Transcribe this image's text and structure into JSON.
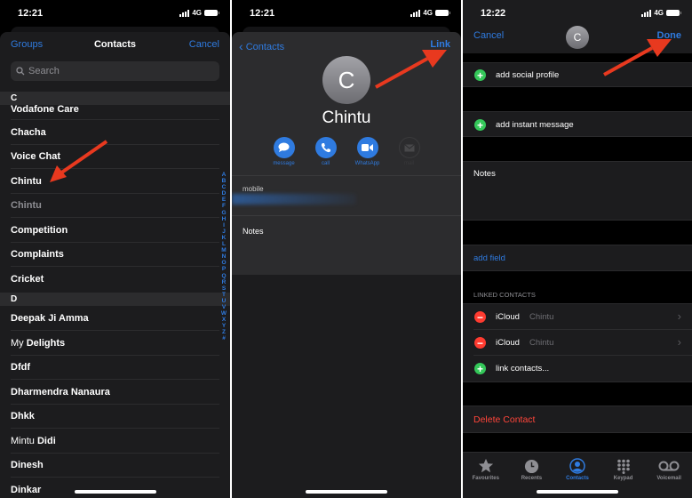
{
  "screen1": {
    "status": {
      "time": "12:21",
      "network": "4G"
    },
    "nav": {
      "left": "Groups",
      "title": "Contacts",
      "right": "Cancel"
    },
    "search": {
      "placeholder": "Search"
    },
    "sections": [
      {
        "letter": "C",
        "rows": [
          {
            "name": "Vodafone Care",
            "style": "bold"
          },
          {
            "name": "Chacha",
            "style": "bold"
          },
          {
            "name": "Voice Chat",
            "style": "bold"
          },
          {
            "name": "Chintu",
            "style": "bold"
          },
          {
            "name": "Chintu",
            "style": "dim"
          },
          {
            "name": "Competition",
            "style": "bold"
          },
          {
            "name": "Complaints",
            "style": "bold"
          },
          {
            "name": "Cricket",
            "style": "bold"
          }
        ]
      },
      {
        "letter": "D",
        "rows": [
          {
            "name": "Deepak Ji Amma",
            "style": "bold"
          },
          {
            "first": "My",
            "last": "Delights",
            "style": "mixed"
          },
          {
            "name": "Dfdf",
            "style": "bold"
          },
          {
            "name": "Dharmendra Nanaura",
            "style": "bold"
          },
          {
            "name": "Dhkk",
            "style": "bold"
          },
          {
            "first": "Mintu",
            "last": "Didi",
            "style": "mixed"
          },
          {
            "name": "Dinesh",
            "style": "bold"
          },
          {
            "name": "Dinkar",
            "style": "bold"
          }
        ]
      }
    ],
    "index": [
      "A",
      "B",
      "C",
      "D",
      "E",
      "F",
      "G",
      "H",
      "I",
      "J",
      "K",
      "L",
      "M",
      "N",
      "O",
      "P",
      "Q",
      "R",
      "S",
      "T",
      "U",
      "V",
      "W",
      "X",
      "Y",
      "Z",
      "#"
    ]
  },
  "screen2": {
    "status": {
      "time": "12:21",
      "network": "4G"
    },
    "nav": {
      "back": "Contacts",
      "right": "Link"
    },
    "avatar_initial": "C",
    "contact_name": "Chintu",
    "actions": [
      {
        "label": "message",
        "icon": "message-icon",
        "enabled": true
      },
      {
        "label": "call",
        "icon": "phone-icon",
        "enabled": true
      },
      {
        "label": "WhatsApp",
        "icon": "video-icon",
        "enabled": true
      },
      {
        "label": "mail",
        "icon": "mail-icon",
        "enabled": false
      }
    ],
    "fields": {
      "mobile_label": "mobile",
      "notes_label": "Notes"
    }
  },
  "screen3": {
    "status": {
      "time": "12:22",
      "network": "4G"
    },
    "nav": {
      "left": "Cancel",
      "right": "Done"
    },
    "avatar_initial": "C",
    "add_social_profile": "add social profile",
    "add_instant_message": "add instant message",
    "notes_label": "Notes",
    "add_field": "add field",
    "linked_header": "LINKED CONTACTS",
    "linked": [
      {
        "source": "iCloud",
        "name": "Chintu"
      },
      {
        "source": "iCloud",
        "name": "Chintu"
      }
    ],
    "link_contacts": "link contacts...",
    "delete_contact": "Delete Contact",
    "tabs": [
      {
        "label": "Favourites",
        "icon": "star-icon",
        "active": false
      },
      {
        "label": "Recents",
        "icon": "clock-icon",
        "active": false
      },
      {
        "label": "Contacts",
        "icon": "person-circle-icon",
        "active": true
      },
      {
        "label": "Keypad",
        "icon": "keypad-icon",
        "active": false
      },
      {
        "label": "Voicemail",
        "icon": "voicemail-icon",
        "active": false
      }
    ]
  },
  "colors": {
    "accent": "#2f7be0",
    "annotation_arrow": "#e8391f",
    "add": "#34c759",
    "remove": "#ff3b30"
  }
}
